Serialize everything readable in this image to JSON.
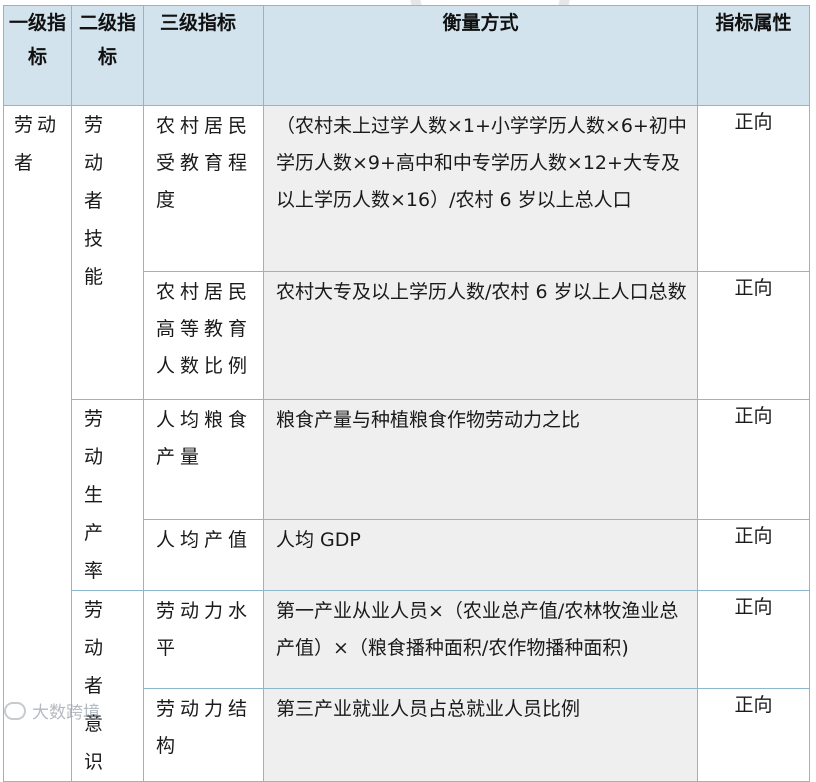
{
  "header": {
    "level1": "一级指标",
    "level2": "二级指标",
    "level3": "三级指标",
    "measure": "衡量方式",
    "attribute": "指标属性"
  },
  "rows": [
    {
      "level1": "劳动者",
      "level2": "劳动者技能",
      "level3": "农村居民受教育程度",
      "measure": "（农村未上过学人数×1+小学学历人数×6+初中学历人数×9+高中和中专学历人数×12+大专及以上学历人数×16）/农村 6 岁以上总人口",
      "attribute": "正向"
    },
    {
      "level3": "农村居民高等教育人数比例",
      "measure": "农村大专及以上学历人数/农村 6 岁以上人口总数",
      "attribute": "正向"
    },
    {
      "level2": "劳动生产率",
      "level3": "人均粮食产量",
      "measure": "粮食产量与种植粮食作物劳动力之比",
      "attribute": "正向"
    },
    {
      "level3": "人均产值",
      "measure": "人均 GDP",
      "attribute": "正向"
    },
    {
      "level2": "劳动者意识",
      "level3": "劳动力水平",
      "measure": "第一产业从业人员×（农业总产值/农林牧渔业总产值）×（粮食播种面积/农作物播种面积)",
      "attribute": "正向"
    },
    {
      "level3": "劳动力结构",
      "measure": "第三产业就业人员占总就业人员比例",
      "attribute": "正向"
    }
  ],
  "watermark": {
    "text": "大数跨境",
    "icon": "watermark-logo-icon"
  }
}
